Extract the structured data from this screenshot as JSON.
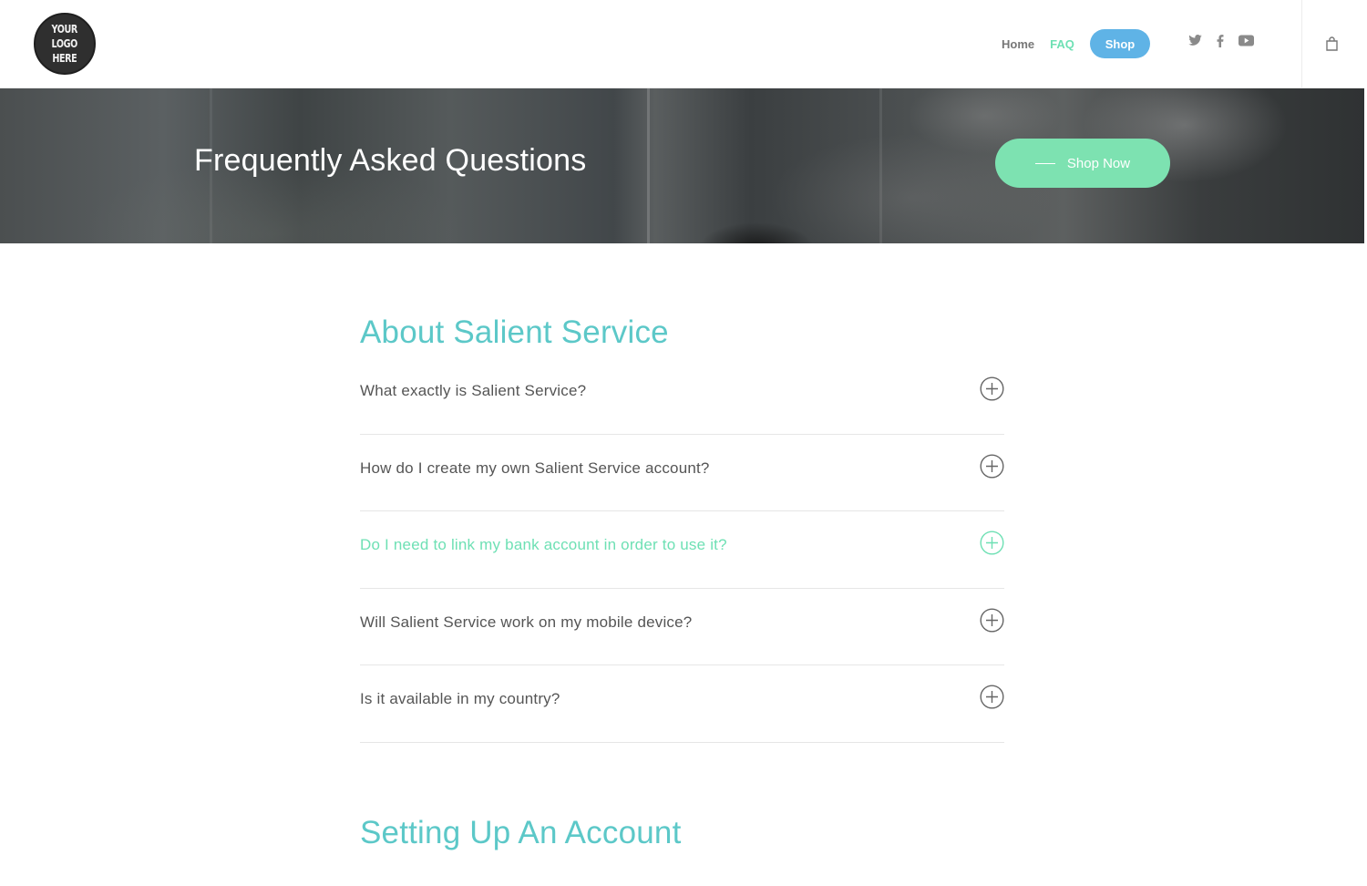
{
  "header": {
    "logo_lines": [
      "YOUR",
      "LOGO",
      "HERE"
    ],
    "nav": [
      {
        "label": "Home",
        "active": false
      },
      {
        "label": "FAQ",
        "active": true
      }
    ],
    "shop_label": "Shop",
    "social_icons": [
      "twitter-icon",
      "facebook-icon",
      "youtube-icon"
    ],
    "cart_icon": "shopping-bag-icon"
  },
  "hero": {
    "title": "Frequently Asked Questions",
    "cta_label": "Shop Now"
  },
  "sections": [
    {
      "title": "About Salient Service",
      "questions": [
        "What exactly is Salient Service?",
        "How do I create my own Salient Service account?",
        "Do I need to link my bank account in order to use it?",
        "Will Salient Service work on my mobile device?",
        "Is it available in my country?"
      ]
    },
    {
      "title": "Setting Up An Account",
      "questions": []
    }
  ],
  "colors": {
    "accent_green": "#7de2b1",
    "accent_teal": "#5cc8c8",
    "shop_blue": "#5fb3e6",
    "nav_active": "#6ee0b4"
  }
}
